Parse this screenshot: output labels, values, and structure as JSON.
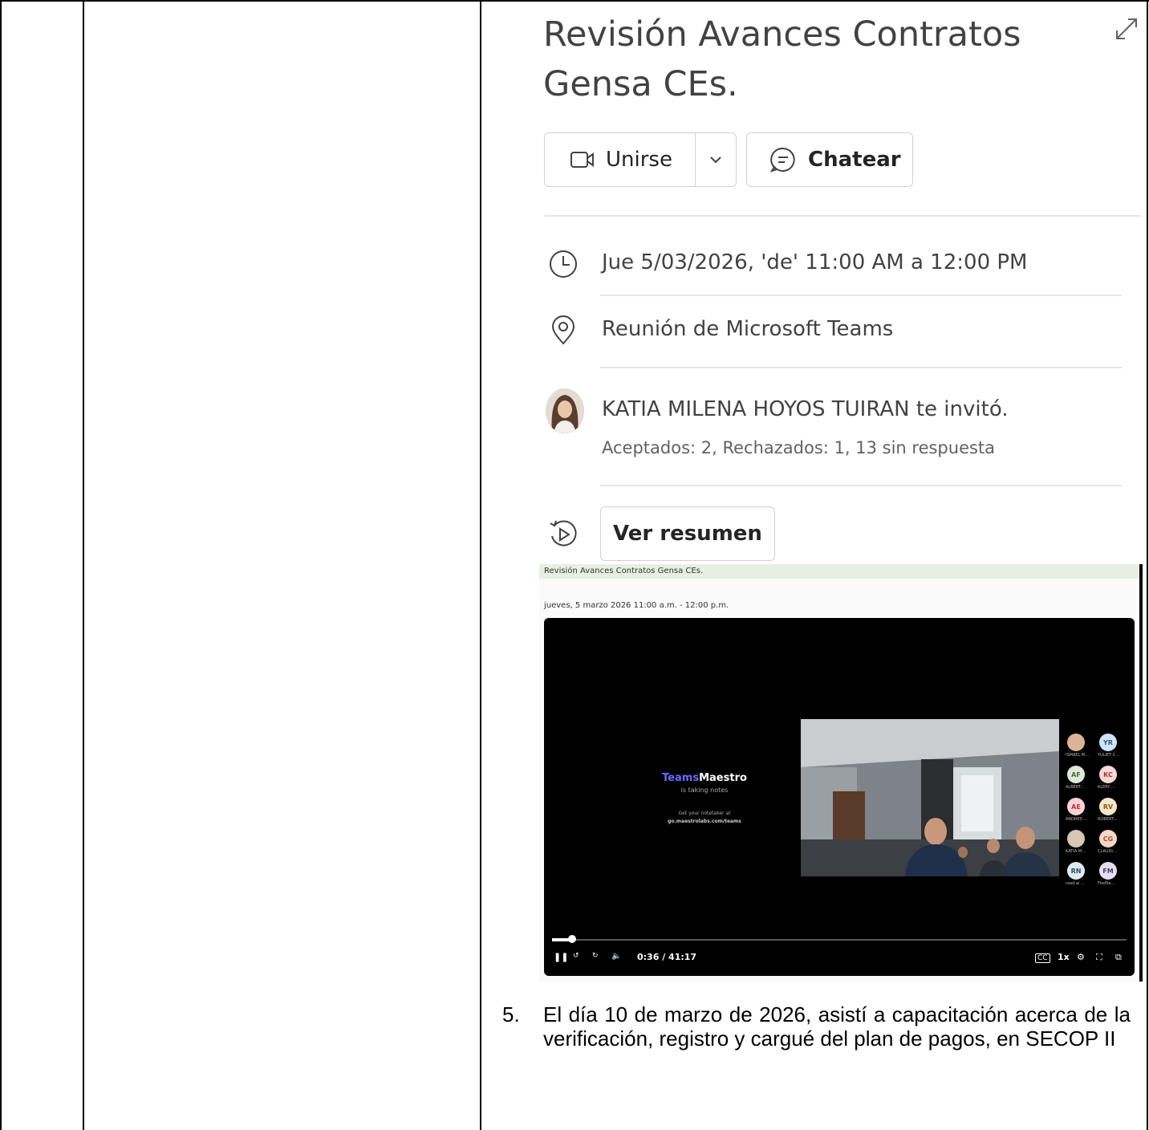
{
  "meeting": {
    "title": "Revisión Avances Contratos Gensa CEs.",
    "join_label": "Unirse",
    "chat_label": "Chatear",
    "datetime": "Jue 5/03/2026, 'de' 11:00 AM a 12:00 PM",
    "location": "Reunión de Microsoft Teams",
    "organizer_line": "KATIA MILENA HOYOS TUIRAN te invitó.",
    "responses": "Aceptados: 2, Rechazados: 1, 13 sin respuesta",
    "summary_label": "Ver resumen"
  },
  "recap": {
    "title": "Revisión Avances Contratos Gensa CEs.",
    "date": "jueves, 5 marzo 2026 11:00 a.m. - 12:00 p.m.",
    "brand_teams": "Teams",
    "brand_maestro": "Maestro",
    "brand_sub": "is taking notes",
    "promo_line1": "Get your notetaker at",
    "promo_line2": "go.maestrolabs.com/teams",
    "time": "0:36 / 41:17",
    "speed": "1x",
    "progress": 0.015,
    "participants": [
      {
        "initials": "",
        "name": "ISMAEL M..."
      },
      {
        "initials": "YR",
        "name": "YULIET C..."
      },
      {
        "initials": "AF",
        "name": "ALBERT..."
      },
      {
        "initials": "KC",
        "name": "KLERY ..."
      },
      {
        "initials": "AE",
        "name": "ANDRES ..."
      },
      {
        "initials": "RV",
        "name": "ROBERT..."
      },
      {
        "initials": "",
        "name": "KATIA M..."
      },
      {
        "initials": "CG",
        "name": "CLAUDI..."
      },
      {
        "initials": "RN",
        "name": "read.ai ..."
      },
      {
        "initials": "FM",
        "name": "Fireflie..."
      }
    ]
  },
  "list_item": {
    "number": "5.",
    "text": "El día 10 de marzo de 2026, asistí a capacitación acerca de la verificación, registro y cargué del plan de pagos, en SECOP II"
  }
}
